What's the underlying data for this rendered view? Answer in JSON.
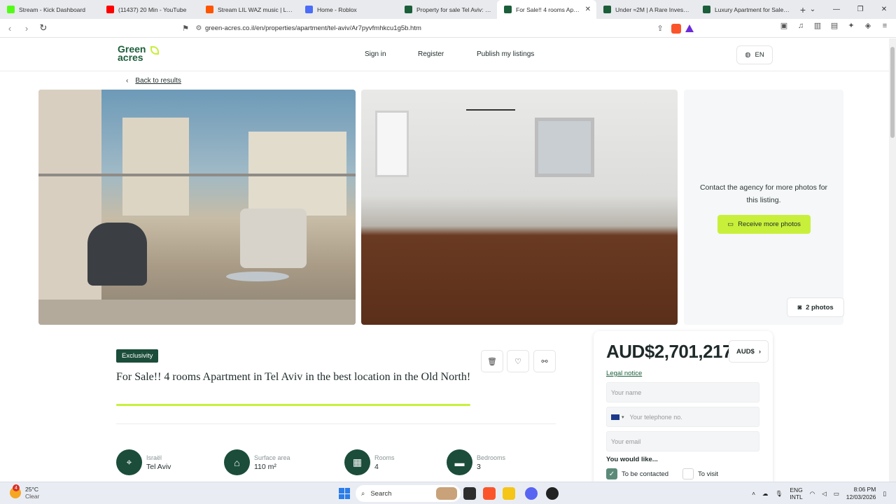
{
  "browser": {
    "tabs": [
      {
        "title": "Stream - Kick Dashboard",
        "color": "#53fc18",
        "active": false
      },
      {
        "title": "(11437) 20 Min - YouTube",
        "color": "#ff0000",
        "active": false
      },
      {
        "title": "Stream LIL WAZ music | Listen",
        "color": "#ff5500",
        "active": false
      },
      {
        "title": "Home - Roblox",
        "color": "#4a6cf7",
        "active": false
      },
      {
        "title": "Property for sale Tel Aviv: 754 ...",
        "color": "#1b5e3a",
        "active": false
      },
      {
        "title": "For Sale!! 4 rooms Apartm...",
        "color": "#1b5e3a",
        "active": true
      },
      {
        "title": "Under ≈2M | A Rare Investmen...",
        "color": "#1b5e3a",
        "active": false
      },
      {
        "title": "Luxury Apartment for Sale in V...",
        "color": "#1b5e3a",
        "active": false
      }
    ],
    "url": "green-acres.co.il/en/properties/apartment/tel-aviv/Ar7pyvfmhkcu1g5b.htm"
  },
  "header": {
    "logo_line1": "Green",
    "logo_line2": "acres",
    "nav": {
      "signin": "Sign in",
      "register": "Register",
      "publish": "Publish my listings"
    },
    "lang": "EN"
  },
  "back_label": "Back to results",
  "photos": {
    "panel_message": "Contact the agency for more photos for this listing.",
    "more_button": "Receive more photos",
    "count_label": "2 photos"
  },
  "listing": {
    "badge": "Exclusivity",
    "title": "For Sale!! 4 rooms Apartment in Tel Aviv in the best location in the Old North!",
    "features": [
      {
        "key": "Israël",
        "value": "Tel Aviv",
        "icon": "location-pin-icon"
      },
      {
        "key": "Surface area",
        "value": "110 m²",
        "icon": "house-icon"
      },
      {
        "key": "Rooms",
        "value": "4",
        "icon": "floorplan-icon"
      },
      {
        "key": "Bedrooms",
        "value": "3",
        "icon": "bed-icon"
      }
    ]
  },
  "contact": {
    "price": "AUD$2,701,217",
    "currency": "AUD$",
    "legal": "Legal notice",
    "name_placeholder": "Your name",
    "phone_placeholder": "Your telephone no.",
    "email_placeholder": "Your email",
    "would_like": "You would like...",
    "opt_contacted": "To be contacted",
    "opt_visit": "To visit"
  },
  "taskbar": {
    "temp": "25°C",
    "condition": "Clear",
    "weather_badge": "4",
    "search": "Search",
    "lang1": "ENG",
    "lang2": "INTL",
    "time": "8:06 PM",
    "date": "12/03/2026"
  }
}
